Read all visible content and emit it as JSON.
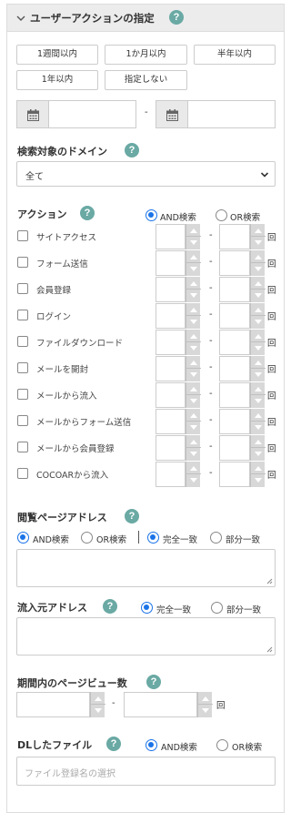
{
  "header": {
    "title": "ユーザーアクションの指定",
    "help": "?"
  },
  "period_buttons": [
    "1週間以内",
    "1か月以内",
    "半年以内",
    "1年以内",
    "指定しない"
  ],
  "date_range": {
    "separator": "-"
  },
  "domain": {
    "label": "検索対象のドメイン",
    "help": "?",
    "selected": "全て"
  },
  "action": {
    "label": "アクション",
    "help": "?",
    "radio_and": "AND検索",
    "radio_or": "OR検索",
    "selected": "AND検索",
    "items": [
      "サイトアクセス",
      "フォーム送信",
      "会員登録",
      "ログイン",
      "ファイルダウンロード",
      "メールを開封",
      "メールから流入",
      "メールからフォーム送信",
      "メールから会員登録",
      "COCOARから流入"
    ],
    "separator": "-",
    "unit": "回"
  },
  "page_address": {
    "label": "閲覧ページアドレス",
    "help": "?",
    "radio_and": "AND検索",
    "radio_or": "OR検索",
    "radio_exact": "完全一致",
    "radio_partial": "部分一致"
  },
  "referrer": {
    "label": "流入元アドレス",
    "help": "?",
    "radio_exact": "完全一致",
    "radio_partial": "部分一致"
  },
  "pageviews": {
    "label": "期間内のページビュー数",
    "help": "?",
    "separator": "-",
    "unit": "回"
  },
  "dl_file": {
    "label": "DLしたファイル",
    "help": "?",
    "radio_and": "AND検索",
    "radio_or": "OR検索",
    "placeholder": "ファイル登録名の選択"
  },
  "colors": {
    "accent": "#1a73e8",
    "help_badge": "#6aa9a4",
    "header_bg": "#ececec"
  }
}
